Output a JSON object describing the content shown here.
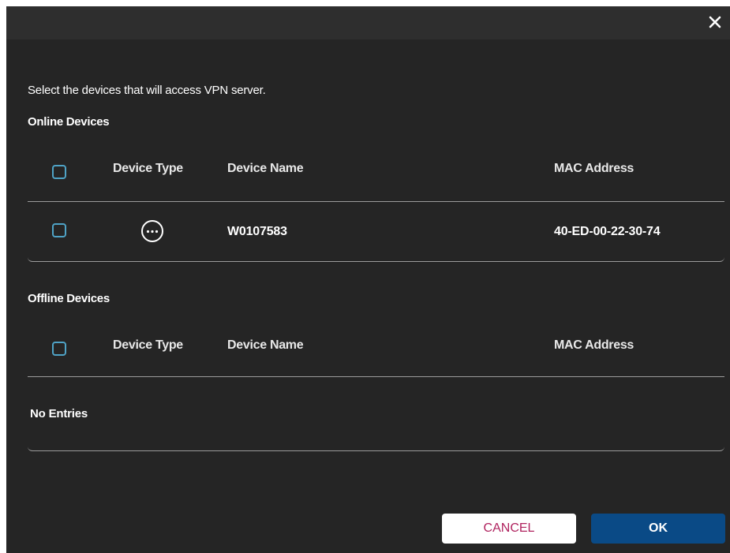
{
  "dialog": {
    "close_label": "×",
    "intro_text": "Select the devices that will access VPN server.",
    "buttons": {
      "cancel_label": "CANCEL",
      "ok_label": "OK"
    },
    "colors": {
      "background": "#252525",
      "checkbox_border": "#4fa3c6",
      "cancel_text": "#b0235f",
      "ok_background": "#0a4a86"
    }
  },
  "online": {
    "title": "Online Devices",
    "headers": {
      "device_type": "Device Type",
      "device_name": "Device Name",
      "mac_address": "MAC Address"
    },
    "rows": [
      {
        "device_type_icon": "more-horizontal-circle-icon",
        "device_name": "W0107583",
        "mac_address": "40-ED-00-22-30-74"
      }
    ]
  },
  "offline": {
    "title": "Offline Devices",
    "headers": {
      "device_type": "Device Type",
      "device_name": "Device Name",
      "mac_address": "MAC Address"
    },
    "empty_text": "No Entries"
  }
}
